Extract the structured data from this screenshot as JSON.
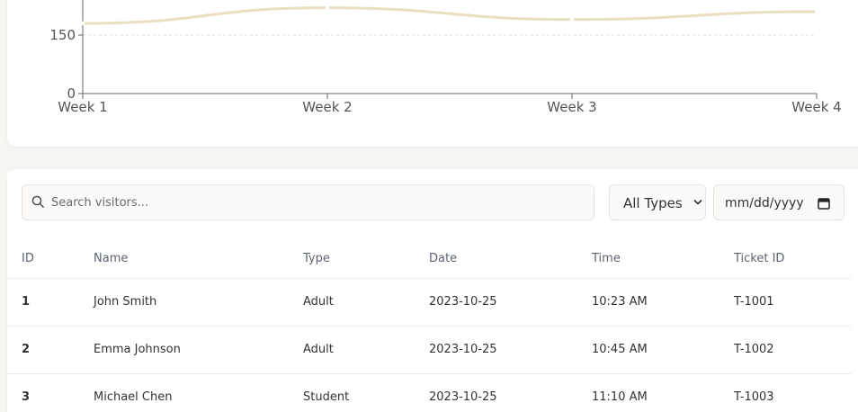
{
  "chart_data": {
    "type": "line",
    "title": "",
    "xlabel": "",
    "ylabel": "",
    "categories": [
      "Week 1",
      "Week 2",
      "Week 3",
      "Week 4"
    ],
    "y_ticks": [
      "0",
      "150"
    ],
    "ylim": [
      0,
      330
    ],
    "grid": "dashed horizontal at 150",
    "series": [
      {
        "values": [
          180,
          220,
          190,
          210
        ],
        "color": "#ebdfc2"
      }
    ]
  },
  "search": {
    "placeholder": "Search visitors..."
  },
  "filters": {
    "type_label": "All Types",
    "date_placeholder": "mm/dd/yyyy"
  },
  "table": {
    "headers": [
      "ID",
      "Name",
      "Type",
      "Date",
      "Time",
      "Ticket ID"
    ],
    "rows": [
      [
        "1",
        "John Smith",
        "Adult",
        "2023-10-25",
        "10:23 AM",
        "T-1001"
      ],
      [
        "2",
        "Emma Johnson",
        "Adult",
        "2023-10-25",
        "10:45 AM",
        "T-1002"
      ],
      [
        "3",
        "Michael Chen",
        "Student",
        "2023-10-25",
        "11:10 AM",
        "T-1003"
      ]
    ]
  }
}
